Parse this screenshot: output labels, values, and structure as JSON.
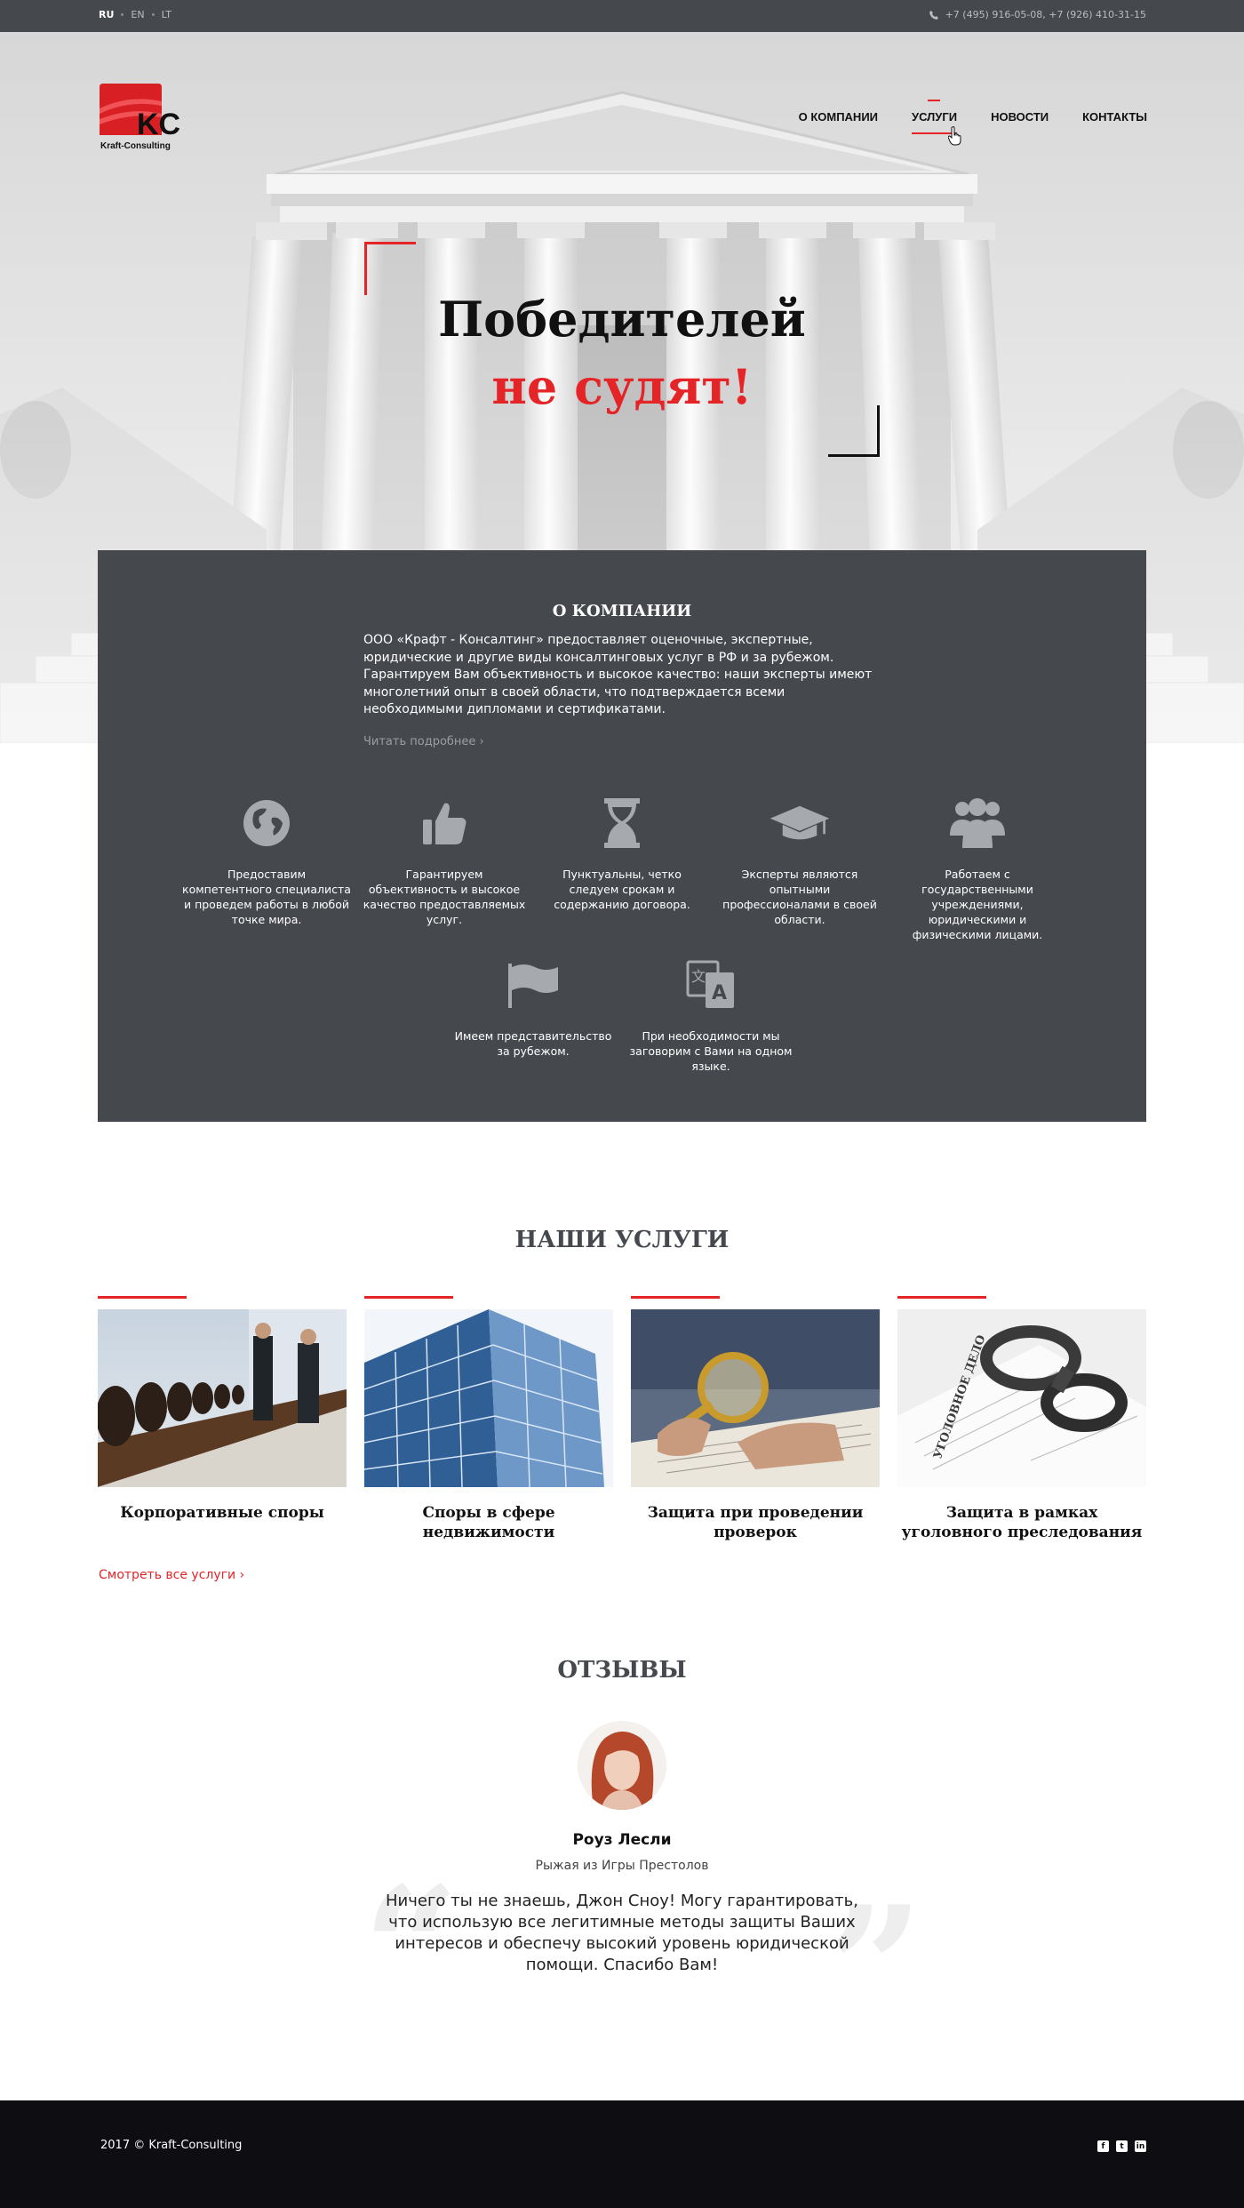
{
  "topbar": {
    "languages": [
      "RU",
      "EN",
      "LT"
    ],
    "active_language": "RU",
    "phones": "+7 (495) 916-05-08, +7 (926) 410-31-15"
  },
  "logo": {
    "initials": "KC",
    "text": "Kraft-Consulting"
  },
  "nav": {
    "items": [
      {
        "label": "О КОМПАНИИ"
      },
      {
        "label": "УСЛУГИ"
      },
      {
        "label": "НОВОСТИ"
      },
      {
        "label": "КОНТАКТЫ"
      }
    ],
    "active": "УСЛУГИ"
  },
  "hero": {
    "line1": "Победителей",
    "line2": "не судят!"
  },
  "about": {
    "title": "О КОМПАНИИ",
    "description": "ООО «Крафт - Консалтинг» предоставляет оценочные, экспертные, юридические и другие виды консалтинговых услуг в РФ и за рубежом. Гарантируем Вам объективность и высокое качество: наши эксперты имеют многолетний опыт в своей области, что подтверждается всеми необходимыми дипломами и сертификатами.",
    "read_more": "Читать подробнее ›",
    "features": [
      {
        "icon": "globe-icon",
        "text": "Предоставим компетентного специалиста и проведем работы в любой точке мира."
      },
      {
        "icon": "thumbs-up-icon",
        "text": "Гарантируем объективность и высокое качество предоставляемых услуг."
      },
      {
        "icon": "hourglass-icon",
        "text": "Пунктуальны, четко следуем срокам и содержанию договора."
      },
      {
        "icon": "graduation-cap-icon",
        "text": "Эксперты являются опытными профессионалами в своей области."
      },
      {
        "icon": "users-icon",
        "text": "Работаем с государственными учреждениями, юридическими и физическими лицами."
      },
      {
        "icon": "flag-icon",
        "text": "Имеем представительство за рубежом."
      },
      {
        "icon": "translate-icon",
        "text": "При необходимости мы заговорим с Вами на одном языке."
      }
    ]
  },
  "services": {
    "title": "НАШИ УСЛУГИ",
    "items": [
      {
        "label": "Корпоративные споры"
      },
      {
        "label": "Споры в сфере недвижимости"
      },
      {
        "label": "Защита при проведении проверок"
      },
      {
        "label": "Защита в рамках уголовного преследования"
      }
    ],
    "all_link": "Смотреть все услуги ›"
  },
  "reviews": {
    "title": "ОТЗЫВЫ",
    "name": "Роуз Лесли",
    "role": "Рыжая из Игры Престолов",
    "quote": "Ничего ты не знаешь, Джон Сноу! Могу гарантировать, что использую все легитимные методы защиты Ваших интересов и обеспечу высокий уровень юридической помощи. Спасибо Вам!"
  },
  "footer": {
    "copyright": "2017 © Kraft-Consulting",
    "social": [
      "facebook-icon",
      "twitter-icon",
      "linkedin-icon"
    ]
  },
  "colors": {
    "accent": "#e52428",
    "dark": "#45484d",
    "footer": "#0d0d12"
  }
}
